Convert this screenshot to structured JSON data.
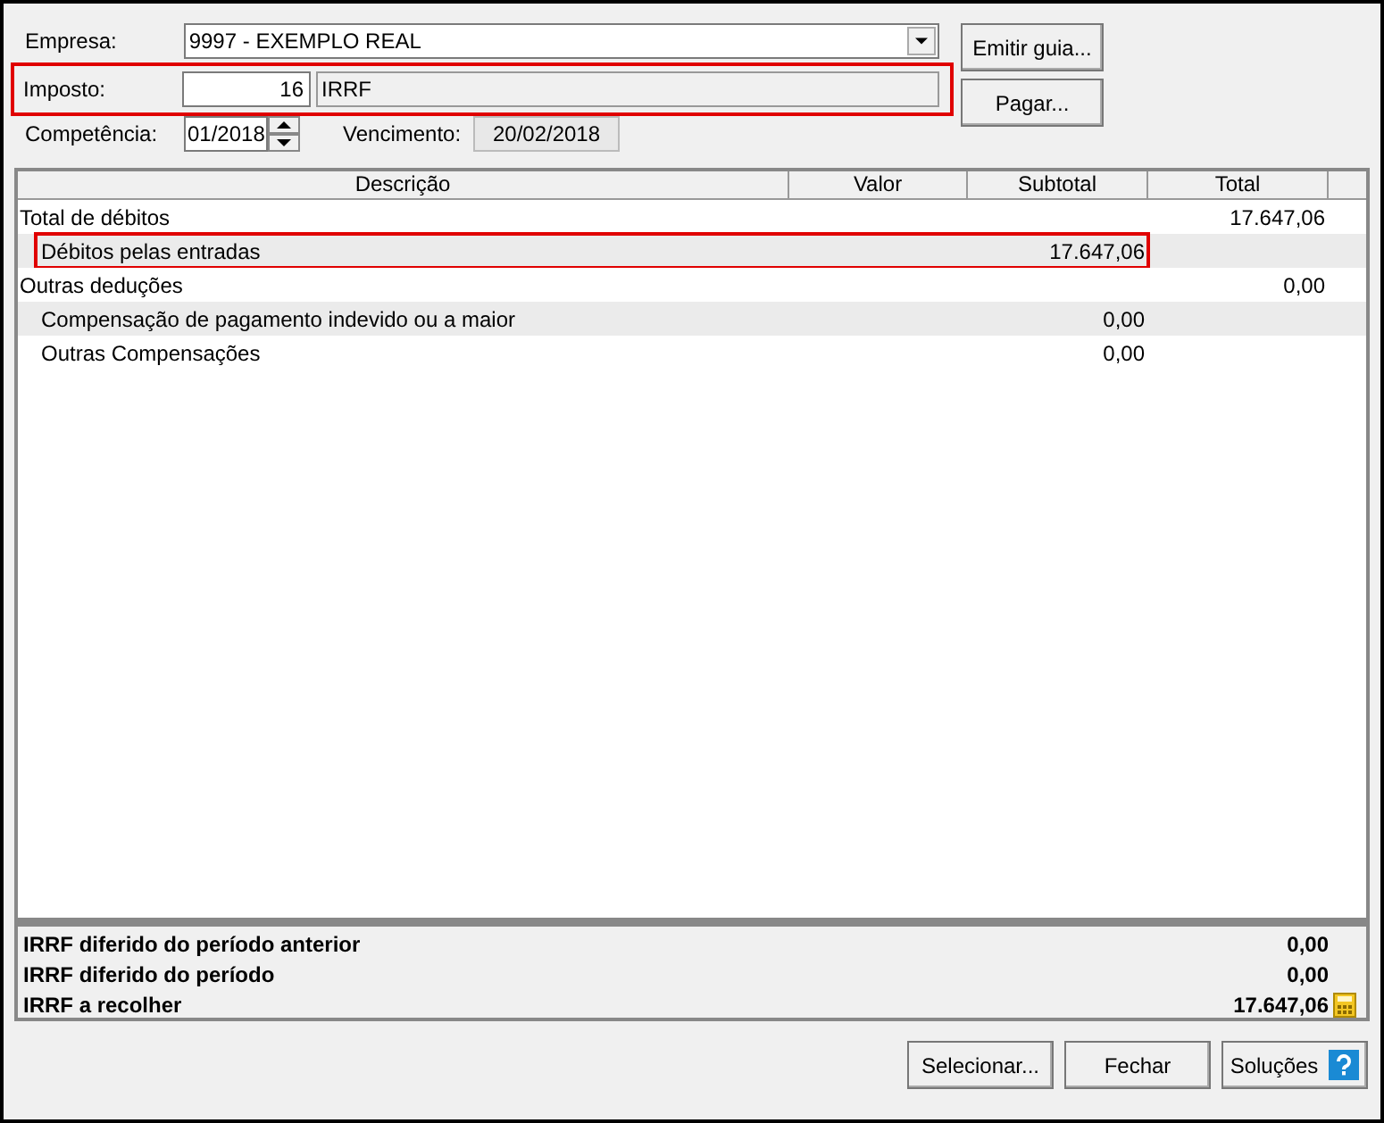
{
  "form": {
    "empresa": {
      "label": "Empresa:",
      "value": "9997 - EXEMPLO REAL"
    },
    "imposto": {
      "label": "Imposto:",
      "code": "16",
      "name": "IRRF",
      "highlighted": true
    },
    "competencia": {
      "label": "Competência:",
      "value": "01/2018"
    },
    "vencimento": {
      "label": "Vencimento:",
      "value": "20/02/2018"
    }
  },
  "side_buttons": [
    "Emitir guia...",
    "Pagar..."
  ],
  "table": {
    "columns": [
      "Descrição",
      "Valor",
      "Subtotal",
      "Total"
    ],
    "rows": [
      {
        "description": "Total de débitos",
        "total": "17.647,06",
        "highlighted": false,
        "children": [
          {
            "description": "Débitos pelas entradas",
            "subtotal": "17.647,06",
            "highlighted": true
          }
        ]
      },
      {
        "description": "Outras deduções",
        "total": "0,00",
        "highlighted": false,
        "children": [
          {
            "description": "Compensação de pagamento indevido ou a maior",
            "subtotal": "0,00",
            "highlighted": false
          },
          {
            "description": "Outras Compensações",
            "subtotal": "0,00",
            "highlighted": false
          }
        ]
      }
    ]
  },
  "summary": [
    {
      "label": "IRRF diferido do período anterior",
      "value": "0,00",
      "kind": "plain"
    },
    {
      "label": "IRRF diferido do período",
      "value": "0,00",
      "kind": "plain"
    },
    {
      "label": "IRRF a recolher",
      "value": "17.647,06",
      "kind": "calculator"
    }
  ],
  "buttons": [
    {
      "label": "Selecionar...",
      "kind": "plain"
    },
    {
      "label": "Fechar",
      "kind": "plain"
    },
    {
      "label": "Soluções",
      "kind": "help"
    }
  ]
}
